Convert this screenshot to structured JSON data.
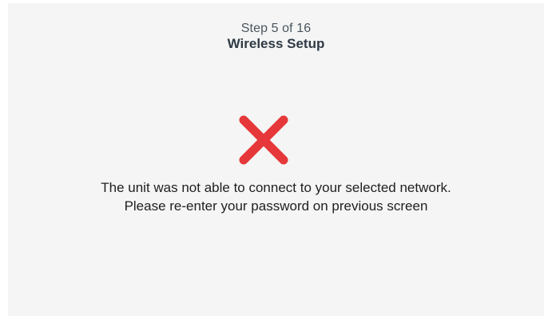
{
  "header": {
    "step_text": "Step 5 of 16",
    "title": "Wireless Setup"
  },
  "status": {
    "icon": "error-x-icon",
    "icon_color": "#e6373a",
    "message_line1": "The unit was not able to connect to your selected network.",
    "message_line2": "Please re-enter your password on previous screen"
  },
  "colors": {
    "background": "#f4f5f4",
    "title_text": "#2f3a45"
  }
}
